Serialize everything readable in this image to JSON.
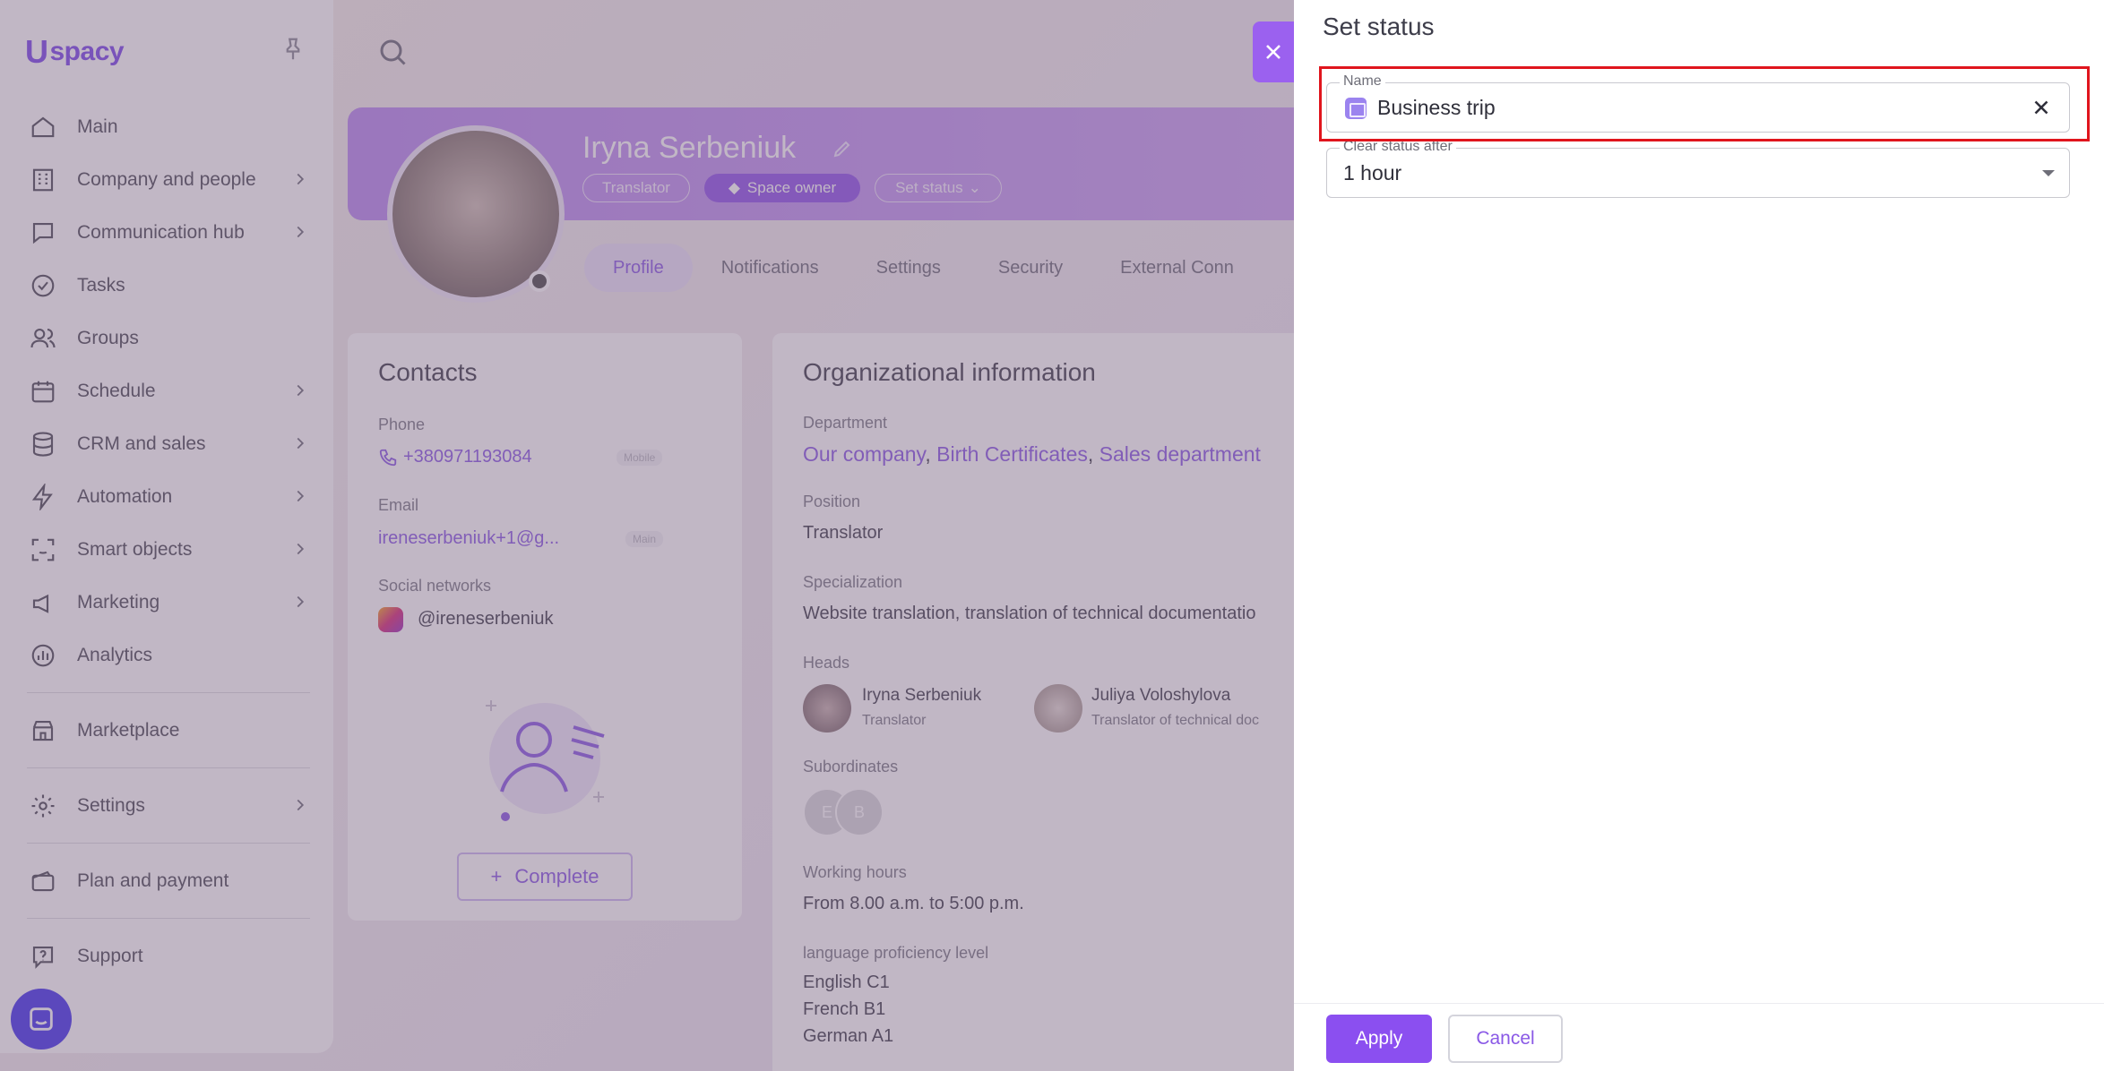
{
  "sidebar": {
    "logo": "spacy",
    "items": [
      {
        "label": "Main",
        "icon": "home-icon"
      },
      {
        "label": "Company and people",
        "icon": "building-icon"
      },
      {
        "label": "Communication hub",
        "icon": "chat-icon"
      },
      {
        "label": "Tasks",
        "icon": "check-circle-icon"
      },
      {
        "label": "Groups",
        "icon": "users-icon"
      },
      {
        "label": "Schedule",
        "icon": "calendar-icon"
      },
      {
        "label": "CRM and sales",
        "icon": "database-icon"
      },
      {
        "label": "Automation",
        "icon": "lightning-icon"
      },
      {
        "label": "Smart objects",
        "icon": "scan-icon"
      },
      {
        "label": "Marketing",
        "icon": "megaphone-icon"
      },
      {
        "label": "Analytics",
        "icon": "chart-icon"
      },
      {
        "label": "Marketplace",
        "icon": "store-icon"
      },
      {
        "label": "Settings",
        "icon": "gear-icon"
      },
      {
        "label": "Plan and payment",
        "icon": "wallet-icon"
      },
      {
        "label": "Support",
        "icon": "help-icon"
      }
    ]
  },
  "profile": {
    "name": "Iryna Serbeniuk",
    "chip_translator": "Translator",
    "chip_owner": "Space owner",
    "chip_status": "Set status",
    "tabs": [
      "Profile",
      "Notifications",
      "Settings",
      "Security",
      "External Conn"
    ]
  },
  "contacts": {
    "title": "Contacts",
    "phone_label": "Phone",
    "phone": "+380971193084",
    "phone_tag": "Mobile",
    "email_label": "Email",
    "email": "ireneserbeniuk+1@g...",
    "email_tag": "Main",
    "social_label": "Social networks",
    "social": "@ireneserbeniuk",
    "complete_label": "Complete"
  },
  "org": {
    "title": "Organizational information",
    "department_label": "Department",
    "departments": [
      "Our company",
      "Birth Certificates",
      "Sales department"
    ],
    "position_label": "Position",
    "position": "Translator",
    "specialization_label": "Specialization",
    "specialization": "Website translation, translation of technical documentatio",
    "heads_label": "Heads",
    "heads": [
      {
        "name": "Iryna Serbeniuk",
        "role": "Translator"
      },
      {
        "name": "Juliya Voloshylova",
        "role": "Translator of technical doc"
      }
    ],
    "subordinates_label": "Subordinates",
    "subordinates": [
      "E",
      "B"
    ],
    "hours_label": "Working hours",
    "hours": "From 8.00 a.m. to 5:00 p.m.",
    "lang_label": "language proficiency level",
    "languages": [
      "English C1",
      "French B1",
      "German A1"
    ]
  },
  "drawer": {
    "title": "Set status",
    "name_label": "Name",
    "name_value": "Business trip",
    "clear_label": "Clear status after",
    "clear_value": "1 hour",
    "apply": "Apply",
    "cancel": "Cancel"
  },
  "colors": {
    "accent": "#8b4ff0",
    "highlight": "#e0151d"
  }
}
